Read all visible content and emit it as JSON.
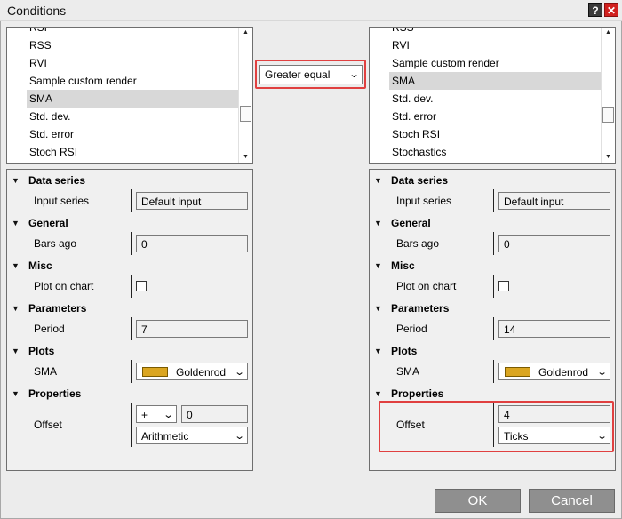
{
  "window": {
    "title": "Conditions",
    "help_glyph": "?",
    "close_glyph": "✕"
  },
  "left_list": {
    "items": [
      "RSI",
      "RSS",
      "RVI",
      "Sample custom render",
      "SMA",
      "Std. dev.",
      "Std. error",
      "Stoch RSI"
    ],
    "selected": "SMA"
  },
  "right_list": {
    "items": [
      "RSS",
      "RVI",
      "Sample custom render",
      "SMA",
      "Std. dev.",
      "Std. error",
      "Stoch RSI",
      "Stochastics"
    ],
    "selected": "SMA"
  },
  "operator": {
    "value": "Greater equal"
  },
  "left_props": {
    "data_series": {
      "header": "Data series",
      "input_series_label": "Input series",
      "input_series_value": "Default input"
    },
    "general": {
      "header": "General",
      "bars_ago_label": "Bars ago",
      "bars_ago_value": "0"
    },
    "misc": {
      "header": "Misc",
      "plot_on_chart_label": "Plot on chart",
      "plot_on_chart_checked": false
    },
    "parameters": {
      "header": "Parameters",
      "period_label": "Period",
      "period_value": "7"
    },
    "plots": {
      "header": "Plots",
      "sma_label": "SMA",
      "sma_color_name": "Goldenrod",
      "sma_color": "#daa520"
    },
    "properties": {
      "header": "Properties",
      "offset_label": "Offset",
      "offset_sign": "+",
      "offset_value": "0",
      "offset_type": "Arithmetic"
    }
  },
  "right_props": {
    "data_series": {
      "header": "Data series",
      "input_series_label": "Input series",
      "input_series_value": "Default input"
    },
    "general": {
      "header": "General",
      "bars_ago_label": "Bars ago",
      "bars_ago_value": "0"
    },
    "misc": {
      "header": "Misc",
      "plot_on_chart_label": "Plot on chart",
      "plot_on_chart_checked": false
    },
    "parameters": {
      "header": "Parameters",
      "period_label": "Period",
      "period_value": "14"
    },
    "plots": {
      "header": "Plots",
      "sma_label": "SMA",
      "sma_color_name": "Goldenrod",
      "sma_color": "#daa520"
    },
    "properties": {
      "header": "Properties",
      "offset_label": "Offset",
      "offset_value": "4",
      "offset_type": "Ticks"
    }
  },
  "buttons": {
    "ok": "OK",
    "cancel": "Cancel"
  },
  "icons": {
    "collapse": "triangle-down-icon",
    "dropdown": "chevron-down-icon",
    "scroll_up": "arrow-up-icon",
    "scroll_down": "arrow-down-icon"
  },
  "colors": {
    "highlight": "#e04040",
    "button": "#8f8f8f",
    "selection": "#d8d8d8"
  }
}
